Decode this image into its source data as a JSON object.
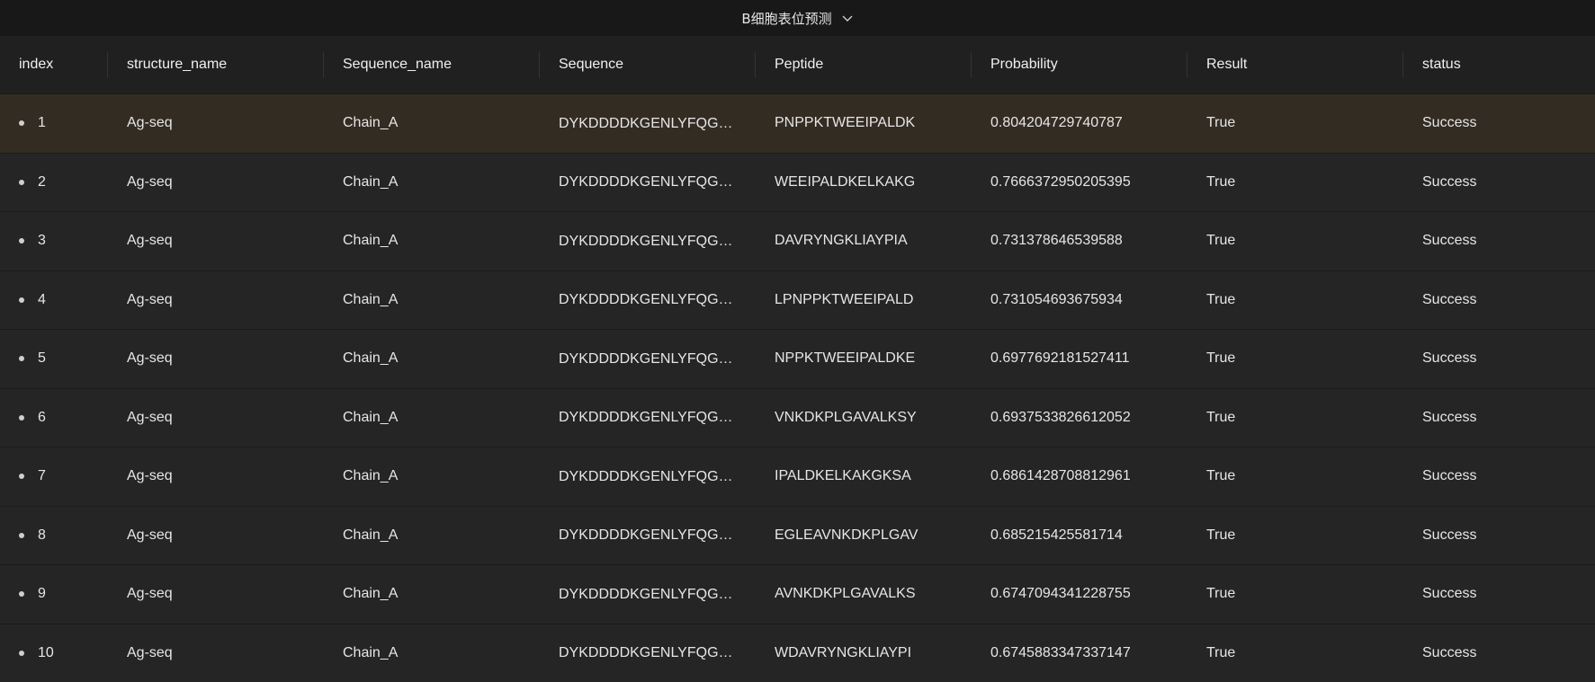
{
  "header": {
    "title": "B细胞表位预测",
    "dropdown_icon": "chevron-down-icon"
  },
  "table": {
    "columns": [
      "index",
      "structure_name",
      "Sequence_name",
      "Sequence",
      "Peptide",
      "Probability",
      "Result",
      "status"
    ],
    "rows": [
      {
        "index": "1",
        "structure_name": "Ag-seq",
        "sequence_name": "Chain_A",
        "sequence": "DYKDDDDKGENLYFQGS...",
        "peptide": "PNPPKTWEEIPALDK",
        "probability": "0.804204729740787",
        "result": "True",
        "status": "Success"
      },
      {
        "index": "2",
        "structure_name": "Ag-seq",
        "sequence_name": "Chain_A",
        "sequence": "DYKDDDDKGENLYFQGS...",
        "peptide": "WEEIPALDKELKAKG",
        "probability": "0.7666372950205395",
        "result": "True",
        "status": "Success"
      },
      {
        "index": "3",
        "structure_name": "Ag-seq",
        "sequence_name": "Chain_A",
        "sequence": "DYKDDDDKGENLYFQGS...",
        "peptide": "DAVRYNGKLIAYPIA",
        "probability": "0.731378646539588",
        "result": "True",
        "status": "Success"
      },
      {
        "index": "4",
        "structure_name": "Ag-seq",
        "sequence_name": "Chain_A",
        "sequence": "DYKDDDDKGENLYFQGS...",
        "peptide": "LPNPPKTWEEIPALD",
        "probability": "0.731054693675934",
        "result": "True",
        "status": "Success"
      },
      {
        "index": "5",
        "structure_name": "Ag-seq",
        "sequence_name": "Chain_A",
        "sequence": "DYKDDDDKGENLYFQGS...",
        "peptide": "NPPKTWEEIPALDKE",
        "probability": "0.6977692181527411",
        "result": "True",
        "status": "Success"
      },
      {
        "index": "6",
        "structure_name": "Ag-seq",
        "sequence_name": "Chain_A",
        "sequence": "DYKDDDDKGENLYFQGS...",
        "peptide": "VNKDKPLGAVALKSY",
        "probability": "0.6937533826612052",
        "result": "True",
        "status": "Success"
      },
      {
        "index": "7",
        "structure_name": "Ag-seq",
        "sequence_name": "Chain_A",
        "sequence": "DYKDDDDKGENLYFQGS...",
        "peptide": "IPALDKELKAKGKSA",
        "probability": "0.6861428708812961",
        "result": "True",
        "status": "Success"
      },
      {
        "index": "8",
        "structure_name": "Ag-seq",
        "sequence_name": "Chain_A",
        "sequence": "DYKDDDDKGENLYFQGS...",
        "peptide": "EGLEAVNKDKPLGAV",
        "probability": "0.685215425581714",
        "result": "True",
        "status": "Success"
      },
      {
        "index": "9",
        "structure_name": "Ag-seq",
        "sequence_name": "Chain_A",
        "sequence": "DYKDDDDKGENLYFQGS...",
        "peptide": "AVNKDKPLGAVALKS",
        "probability": "0.6747094341228755",
        "result": "True",
        "status": "Success"
      },
      {
        "index": "10",
        "structure_name": "Ag-seq",
        "sequence_name": "Chain_A",
        "sequence": "DYKDDDDKGENLYFQGS...",
        "peptide": "WDAVRYNGKLIAYPI",
        "probability": "0.6745883347337147",
        "result": "True",
        "status": "Success"
      }
    ]
  },
  "colors": {
    "background": "#1f1f1f",
    "selected_row": "#332c23",
    "row": "#252525"
  }
}
